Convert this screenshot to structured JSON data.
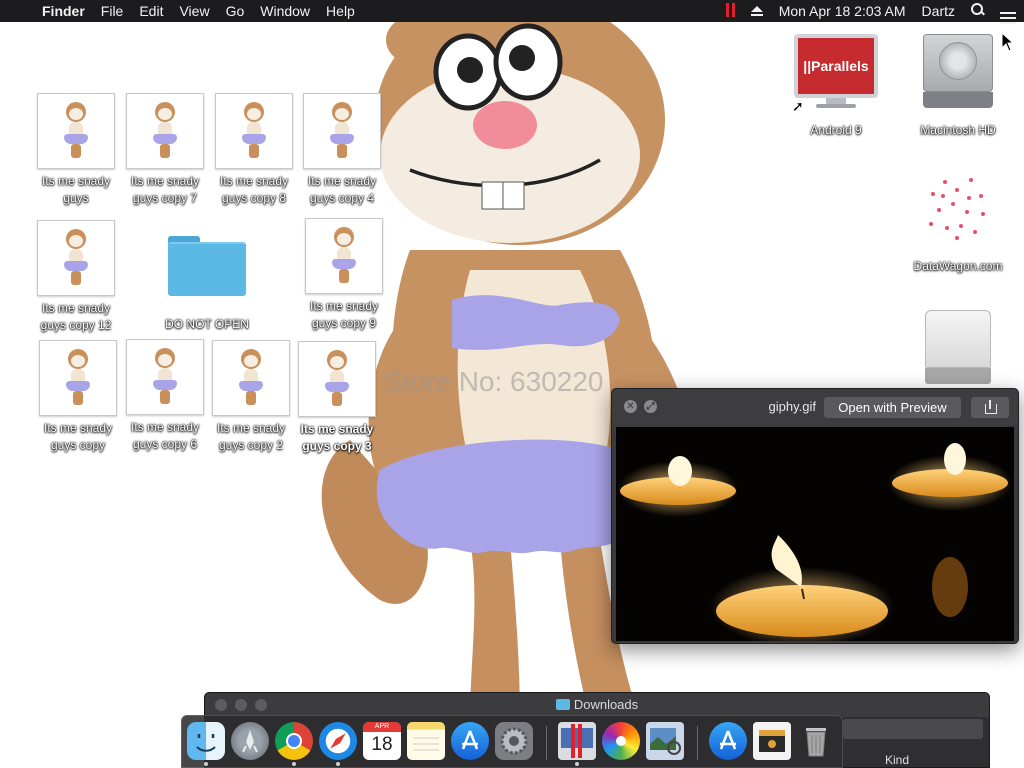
{
  "menubar": {
    "app_name": "Finder",
    "menus": [
      "File",
      "Edit",
      "View",
      "Go",
      "Window",
      "Help"
    ],
    "datetime": "Mon Apr 18  2:03 AM",
    "user": "Dartz"
  },
  "wallpaper": {
    "watermark": "Store No: 630220"
  },
  "desktop": {
    "icons": [
      {
        "label": "Its me snady guys"
      },
      {
        "label": "Its me snady guys copy 7"
      },
      {
        "label": "Its me snady guys copy 8"
      },
      {
        "label": "Its me snady guys copy 4"
      },
      {
        "label": "Its me snady guys copy 12"
      },
      {
        "label": "DO NOT OPEN"
      },
      {
        "label": "Its me snady guys copy 9"
      },
      {
        "label": "Its me snady guys copy"
      },
      {
        "label": "Its me snady guys copy 6"
      },
      {
        "label": "Its me snady guys copy 2"
      },
      {
        "label": "Its me snady guys copy 3"
      },
      {
        "label": "Android 9",
        "logo_text": "||Parallels"
      },
      {
        "label": "Macintosh HD"
      },
      {
        "label": "DataWagon.com"
      },
      {
        "label": ""
      }
    ]
  },
  "quicklook": {
    "filename": "giphy.gif",
    "open_button": "Open with Preview"
  },
  "downloads_window": {
    "title": "Downloads",
    "column_kind": "Kind"
  },
  "dock": {
    "items": [
      {
        "name": "finder-icon",
        "running": true
      },
      {
        "name": "launchpad-icon",
        "running": false
      },
      {
        "name": "chrome-icon",
        "running": true
      },
      {
        "name": "safari-icon",
        "running": true
      },
      {
        "name": "calendar-icon",
        "running": false,
        "month": "APR",
        "day": "18"
      },
      {
        "name": "notes-icon",
        "running": false
      },
      {
        "name": "app-store-icon",
        "running": false
      },
      {
        "name": "system-preferences-icon",
        "running": false
      },
      {
        "name": "parallels-icon",
        "running": true
      },
      {
        "name": "photos-icon",
        "running": false
      },
      {
        "name": "preview-icon",
        "running": false
      },
      {
        "name": "app-store-downloads-icon",
        "running": false
      },
      {
        "name": "archive-icon",
        "running": false
      },
      {
        "name": "trash-icon",
        "running": false
      }
    ]
  }
}
